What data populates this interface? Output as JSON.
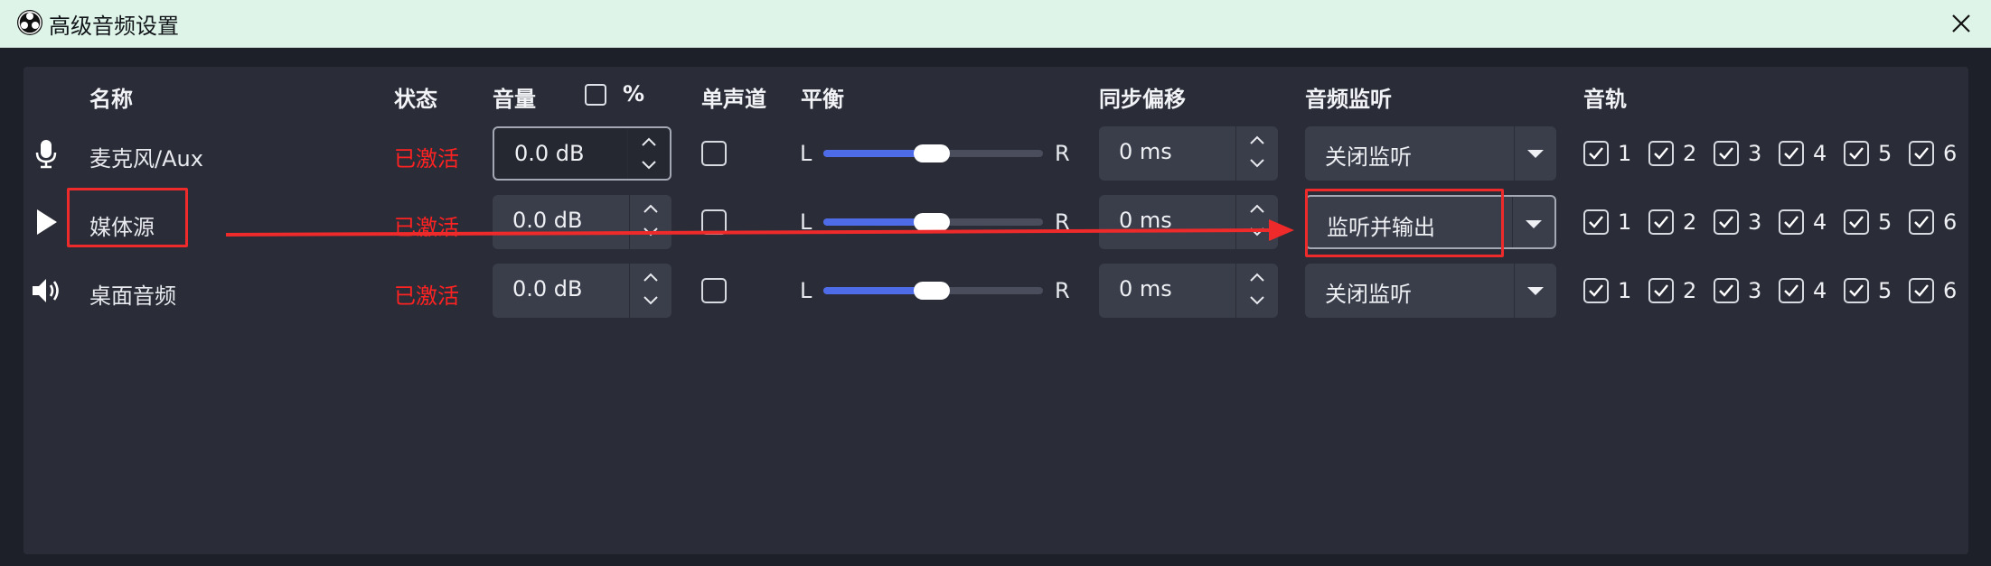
{
  "window": {
    "title": "高级音频设置"
  },
  "headers": {
    "name": "名称",
    "status": "状态",
    "volume": "音量",
    "percent": "%",
    "mono": "单声道",
    "balance": "平衡",
    "sync_offset": "同步偏移",
    "monitoring": "音频监听",
    "tracks": "音轨"
  },
  "balance_labels": {
    "left": "L",
    "right": "R"
  },
  "rows": [
    {
      "icon": "microphone-icon",
      "name": "麦克风/Aux",
      "status": "已激活",
      "volume": "0.0 dB",
      "mono": false,
      "balance": 0.5,
      "sync": "0 ms",
      "monitoring": "关闭监听",
      "tracks": [
        {
          "label": "1",
          "checked": true
        },
        {
          "label": "2",
          "checked": true
        },
        {
          "label": "3",
          "checked": true
        },
        {
          "label": "4",
          "checked": true
        },
        {
          "label": "5",
          "checked": true
        },
        {
          "label": "6",
          "checked": true
        }
      ]
    },
    {
      "icon": "play-icon",
      "name": "媒体源",
      "status": "已激活",
      "volume": "0.0 dB",
      "mono": false,
      "balance": 0.5,
      "sync": "0 ms",
      "monitoring": "监听并输出",
      "tracks": [
        {
          "label": "1",
          "checked": true
        },
        {
          "label": "2",
          "checked": true
        },
        {
          "label": "3",
          "checked": true
        },
        {
          "label": "4",
          "checked": true
        },
        {
          "label": "5",
          "checked": true
        },
        {
          "label": "6",
          "checked": true
        }
      ]
    },
    {
      "icon": "speaker-icon",
      "name": "桌面音频",
      "status": "已激活",
      "volume": "0.0 dB",
      "mono": false,
      "balance": 0.5,
      "sync": "0 ms",
      "monitoring": "关闭监听",
      "tracks": [
        {
          "label": "1",
          "checked": true
        },
        {
          "label": "2",
          "checked": true
        },
        {
          "label": "3",
          "checked": true
        },
        {
          "label": "4",
          "checked": true
        },
        {
          "label": "5",
          "checked": true
        },
        {
          "label": "6",
          "checked": true
        }
      ]
    }
  ],
  "colors": {
    "status_active": "#ff2222",
    "slider_fill": "#4f6ce8",
    "annotation": "#ee2a2a"
  }
}
